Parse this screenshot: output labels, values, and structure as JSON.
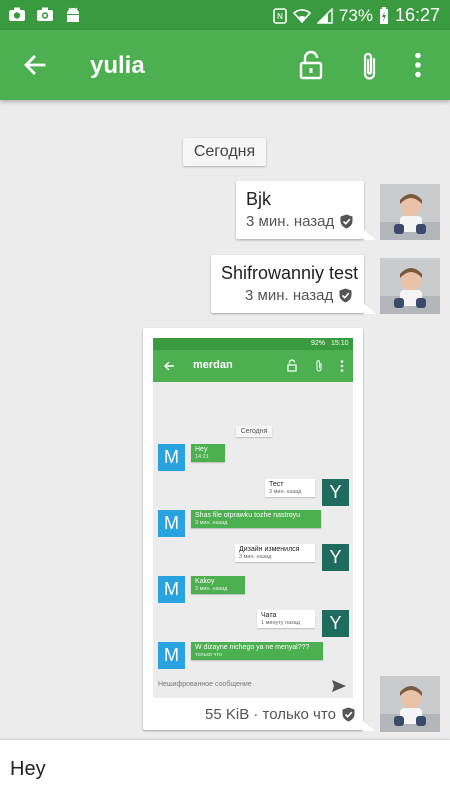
{
  "status_bar": {
    "battery": "73%",
    "time": "16:27"
  },
  "app_bar": {
    "title": "yulia"
  },
  "date_label": "Сегодня",
  "messages": [
    {
      "text": "Bjk",
      "meta": "3 мин. назад"
    },
    {
      "text": "Shifrowanniy test",
      "meta": "3 мин. назад"
    },
    {
      "meta": "55 KiB · только что"
    }
  ],
  "screenshot": {
    "status_battery": "92%",
    "status_time": "15:10",
    "title": "merdan",
    "date_label": "Сегодня",
    "avatar_m": "M",
    "avatar_y": "Y",
    "messages": [
      {
        "text": "Hey",
        "meta": "14:21"
      },
      {
        "text": "Тест",
        "meta": "3 мин. назад"
      },
      {
        "text": "Shas file otprawku tozhe nastroyu",
        "meta": "3 мин. назад"
      },
      {
        "text": "Дизайн изменился",
        "meta": "3 мин. назад"
      },
      {
        "text": "Kakoy",
        "meta": "2 мин. назад"
      },
      {
        "text": "Чата",
        "meta": "1 минуту назад"
      },
      {
        "text": "W dizayne nichego ya ne menyal???",
        "meta": "только что"
      }
    ],
    "composer_placeholder": "Нешифрованное сообщение"
  },
  "composer": {
    "value": "Hey"
  },
  "colors": {
    "primary": "#4caf50",
    "primary_dark": "#3a9a3f",
    "avatar_m": "#29a3e0",
    "avatar_y": "#1f6b5e"
  },
  "icons": [
    "camera-icon",
    "screenshot-icon",
    "android-icon",
    "nfc-icon",
    "wifi-icon",
    "signal-icon",
    "battery-icon",
    "back-arrow-icon",
    "lock-open-icon",
    "attach-icon",
    "more-vert-icon",
    "shield-check-icon",
    "send-icon"
  ]
}
